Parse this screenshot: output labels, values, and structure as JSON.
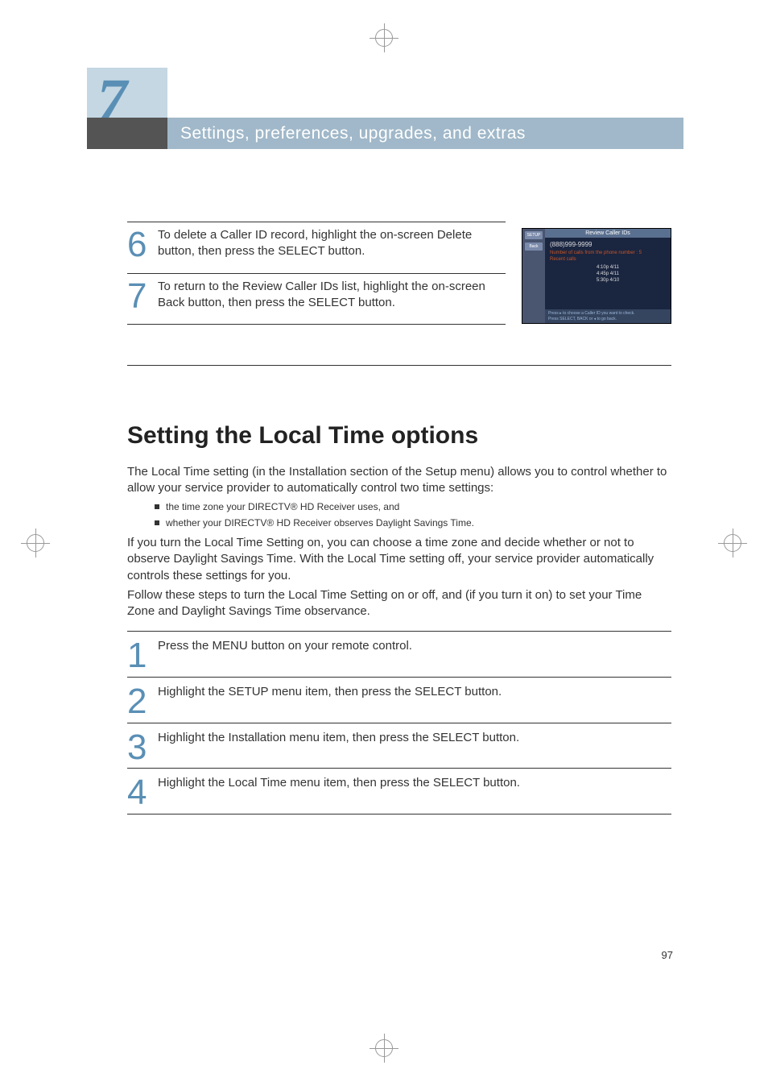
{
  "chapter": {
    "number": "7",
    "title": "Settings, preferences, upgrades, and extras"
  },
  "top_steps": [
    {
      "number": "6",
      "text": "To delete a Caller ID record, highlight the on-screen Delete button, then press the SELECT button."
    },
    {
      "number": "7",
      "text": "To return to the Review Caller IDs list, highlight the on-screen Back button, then press the SELECT button."
    }
  ],
  "screenshot": {
    "title": "Review Caller IDs",
    "sidebar_setup": "SETUP",
    "sidebar_back": "Back",
    "phone": "(888)999-9999",
    "calls_label": "Number of calls from the phone number : 5",
    "recent_label": "Recent calls",
    "times": [
      "4:10p 4/11",
      "4:45p 4/11",
      "5:30p 4/10"
    ],
    "footer1": "Press ▸ to choose a Caller ID you want to check.",
    "footer2": "Press SELECT, BACK or ◂ to go back."
  },
  "section": {
    "heading": "Setting the Local Time options",
    "intro": "The Local Time setting (in the Installation section of the Setup menu) allows you to control whether to allow your service provider to automatically control two time settings:",
    "bullets": [
      "the time zone your DIRECTV® HD Receiver uses, and",
      "whether your DIRECTV® HD Receiver observes Daylight Savings Time."
    ],
    "para2": "If you turn the Local Time Setting on, you can choose a time zone and decide whether or not to observe Daylight Savings Time. With the Local Time setting off, your service provider automatically controls these settings for you.",
    "para3": "Follow these steps to turn the Local Time Setting on or off, and (if you turn it on) to set your Time Zone and Daylight Savings Time observance."
  },
  "numbered_steps": [
    {
      "number": "1",
      "text": "Press the MENU button on your remote control."
    },
    {
      "number": "2",
      "text": "Highlight the SETUP menu item, then press the SELECT button."
    },
    {
      "number": "3",
      "text": "Highlight the Installation menu item, then press the SELECT button."
    },
    {
      "number": "4",
      "text": "Highlight the Local Time menu item, then press the SELECT button."
    }
  ],
  "page_number": "97"
}
